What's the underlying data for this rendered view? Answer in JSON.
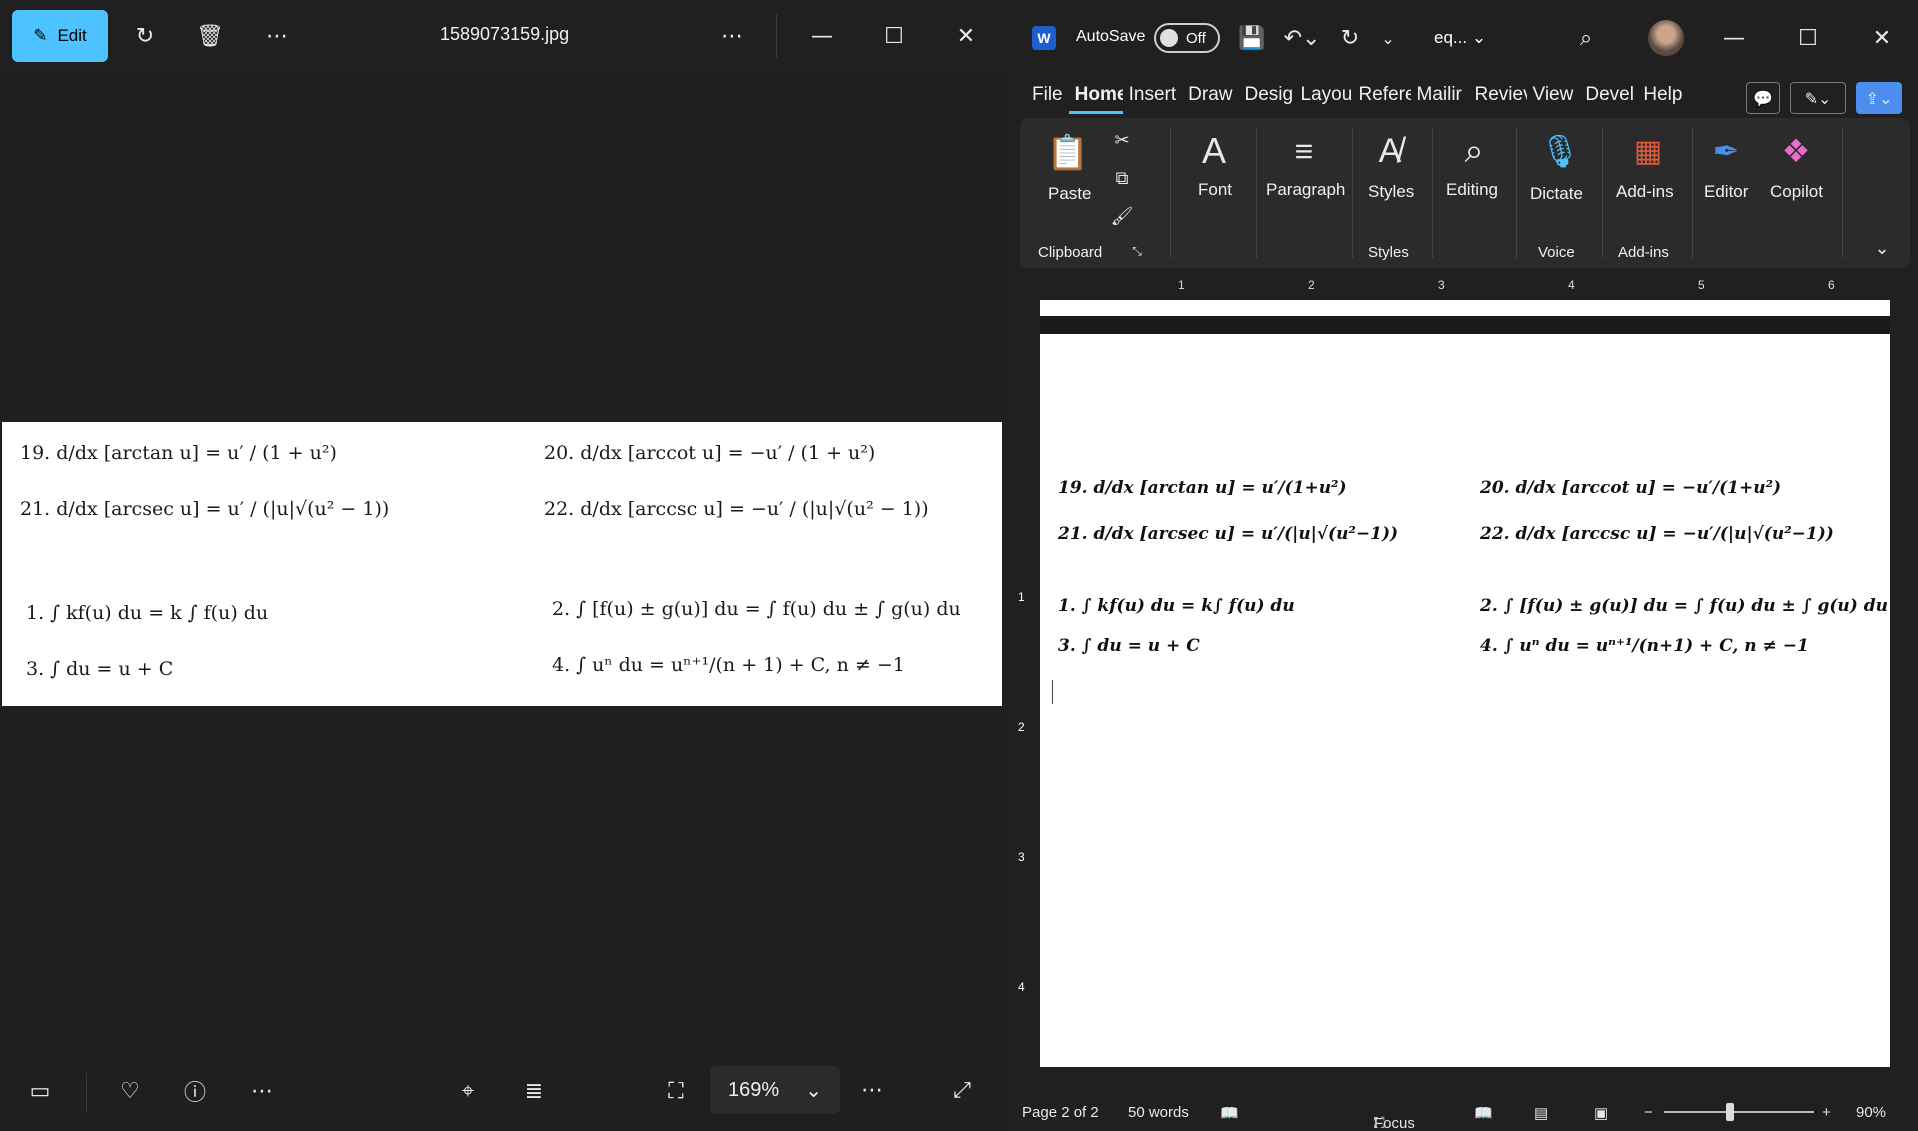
{
  "photos": {
    "edit_label": "Edit",
    "filename": "1589073159.jpg",
    "zoom": "169%",
    "image_lines": [
      "19. d/dx [arctan u] = u′ / (1 + u²)",
      "20. d/dx [arccot u] = −u′ / (1 + u²)",
      "21. d/dx [arcsec u] = u′ / (|u|√(u² − 1))",
      "22. d/dx [arccsc u] = −u′ / (|u|√(u² − 1))",
      "1. ∫ kf(u) du = k ∫ f(u) du",
      "2. ∫ [f(u) ± g(u)] du = ∫ f(u) du ± ∫ g(u) du",
      "3. ∫ du = u + C",
      "4. ∫ uⁿ du = uⁿ⁺¹/(n + 1) + C,  n ≠ −1"
    ]
  },
  "word": {
    "autosave_label": "AutoSave",
    "autosave_state": "Off",
    "doc_name": "eq...",
    "tabs": [
      "File",
      "Home",
      "Insert",
      "Draw",
      "Desig",
      "Layou",
      "Refere",
      "Mailir",
      "Reviev",
      "View",
      "Devel",
      "Help"
    ],
    "ribbon": {
      "paste": "Paste",
      "clipboard": "Clipboard",
      "font": "Font",
      "paragraph": "Paragraph",
      "styles": "Styles",
      "styles_group": "Styles",
      "editing": "Editing",
      "dictate": "Dictate",
      "voice": "Voice",
      "addins": "Add-ins",
      "addins_group": "Add-ins",
      "editor": "Editor",
      "copilot": "Copilot"
    },
    "ruler_numbers": [
      "1",
      "2",
      "3",
      "4",
      "5",
      "6"
    ],
    "vruler_numbers": [
      "1",
      "2",
      "3",
      "4"
    ],
    "equations": [
      "19.  d/dx [arctan u] = u′/(1+u²)",
      "20.  d/dx [arccot u] = −u′/(1+u²)",
      "21.  d/dx [arcsec u] = u′/(|u|√(u²−1))",
      "22.  d/dx [arccsc u] = −u′/(|u|√(u²−1))",
      "1.  ∫ kf(u) du = k∫ f(u) du",
      "2.  ∫ [f(u) ± g(u)] du = ∫ f(u) du ± ∫ g(u) du",
      "3.  ∫ du = u + C",
      "4.  ∫ uⁿ du = uⁿ⁺¹/(n+1) + C,  n ≠ −1"
    ],
    "status": {
      "page": "Page 2 of 2",
      "words": "50 words",
      "focus": "Focus",
      "zoom": "90%"
    }
  }
}
